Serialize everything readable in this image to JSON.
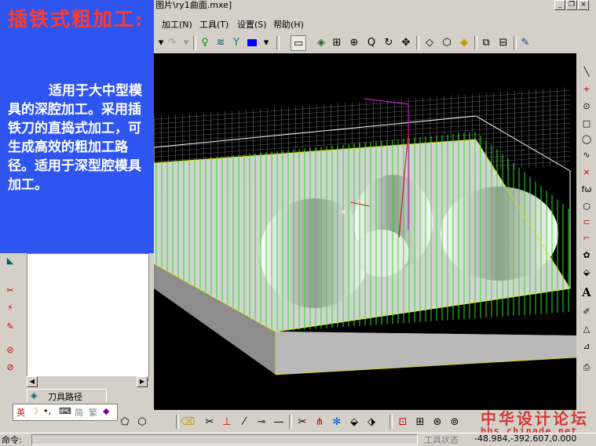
{
  "window": {
    "title": "图片\\ry1曲面.mxe]"
  },
  "window_buttons": {
    "minimize": "_",
    "restore": "❐",
    "close": "×"
  },
  "menu": [
    "加工(N)",
    "工具(T)",
    "设置(S)",
    "帮助(H)"
  ],
  "overlay": {
    "heading": "插铁式粗加工:",
    "body": "适用于大中型模具的深腔加工。采用插铁刀的直捣式加工，可生成高效的粗加工路径。适用于深型腔模具加工。"
  },
  "tree_tab": {
    "label": "刀具路径"
  },
  "ime": {
    "lang": "英",
    "mode": "简",
    "label": "繁"
  },
  "watermark": {
    "line1": "中华设计论坛",
    "line2": "bbs.chinade.net"
  },
  "status": {
    "command_label": "命令:",
    "tool_state_label": "工具状态",
    "coords": "-48.984,-392.607,0.000"
  },
  "colors": {
    "panel_blue": "#2f55f0",
    "heading_red": "#ff3a2a",
    "toolpath_green": "#28e028"
  }
}
